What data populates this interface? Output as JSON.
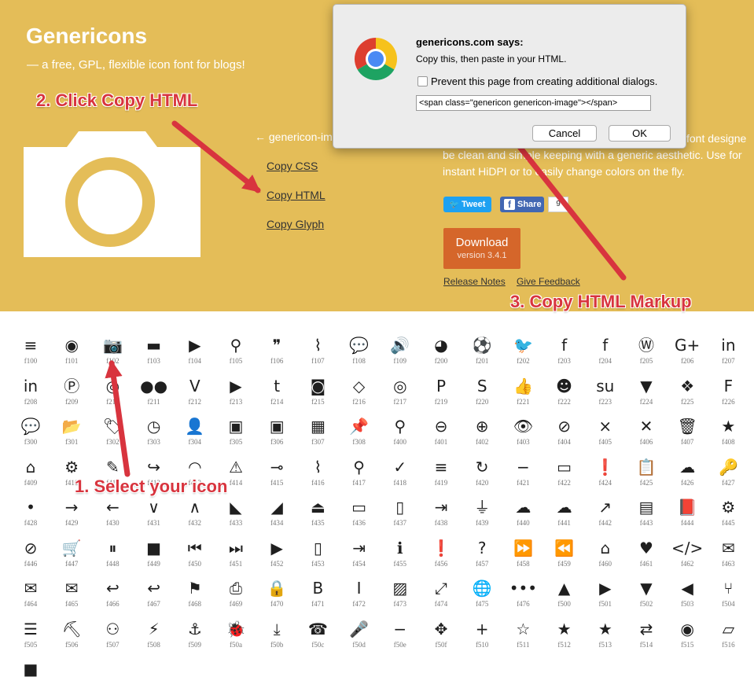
{
  "site": {
    "title": "Genericons",
    "tagline": "— a free, GPL, flexible icon font for blogs!"
  },
  "selected_icon": {
    "name": "← genericon-im",
    "copy_css": "Copy CSS",
    "copy_html": "Copy HTML",
    "copy_glyph": "Copy Glyph"
  },
  "description": {
    "line1": "font designe",
    "line2": "be clean and simple keeping with a generic aesthetic. Use for",
    "line3": "instant HiDPI or to easily change colors on the fly."
  },
  "social": {
    "tweet": "Tweet",
    "share": "Share",
    "count": "9"
  },
  "download": {
    "label": "Download",
    "version": "version 3.4.1"
  },
  "links": {
    "release_notes": "Release Notes",
    "give_feedback": "Give Feedback"
  },
  "annotations": {
    "step1": "1. Select your icon",
    "step2": "2. Click Copy HTML",
    "step3": "3. Copy HTML Markup"
  },
  "dialog": {
    "title": "genericons.com says:",
    "message": "Copy this, then paste in your HTML.",
    "checkbox_label": "Prevent this page from creating additional dialogs.",
    "input_value": "<span class=\"genericon genericon-image\"></span>",
    "cancel": "Cancel",
    "ok": "OK"
  },
  "colors": {
    "header_bg": "#e4bd58",
    "annotation_red": "#d8343e",
    "download_orange": "#d5662a",
    "tweet_blue": "#1da1f2",
    "facebook_blue": "#4267b2"
  },
  "icons": [
    [
      {
        "g": "≡",
        "c": "f100"
      },
      {
        "g": "◉",
        "c": "f101"
      },
      {
        "g": "📷",
        "c": "f102"
      },
      {
        "g": "▬",
        "c": "f103"
      },
      {
        "g": "▶",
        "c": "f104"
      },
      {
        "g": "⚲",
        "c": "f105"
      },
      {
        "g": "❞",
        "c": "f106"
      },
      {
        "g": "⌇",
        "c": "f107"
      },
      {
        "g": "💬",
        "c": "f108"
      },
      {
        "g": "🔊",
        "c": "f109"
      },
      {
        "g": "◕",
        "c": "f200"
      },
      {
        "g": "⚽",
        "c": "f201"
      },
      {
        "g": "🐦",
        "c": "f202"
      },
      {
        "g": "f",
        "c": "f203"
      },
      {
        "g": "f",
        "c": "f204"
      },
      {
        "g": "Ⓦ",
        "c": "f205"
      },
      {
        "g": "G+",
        "c": "f206"
      },
      {
        "g": "in",
        "c": "f207"
      }
    ],
    [
      {
        "g": "in",
        "c": "f208"
      },
      {
        "g": "Ⓟ",
        "c": "f209"
      },
      {
        "g": "◎",
        "c": "f210"
      },
      {
        "g": "●●",
        "c": "f211"
      },
      {
        "g": "V",
        "c": "f212"
      },
      {
        "g": "▶",
        "c": "f213"
      },
      {
        "g": "t",
        "c": "f214"
      },
      {
        "g": "◙",
        "c": "f215"
      },
      {
        "g": "◇",
        "c": "f216"
      },
      {
        "g": "◎",
        "c": "f217"
      },
      {
        "g": "P",
        "c": "f219"
      },
      {
        "g": "S",
        "c": "f220"
      },
      {
        "g": "👍",
        "c": "f221"
      },
      {
        "g": "☻",
        "c": "f222"
      },
      {
        "g": "su",
        "c": "f223"
      },
      {
        "g": "▼",
        "c": "f224"
      },
      {
        "g": "❖",
        "c": "f225"
      },
      {
        "g": "F",
        "c": "f226"
      }
    ],
    [
      {
        "g": "💬",
        "c": "f300"
      },
      {
        "g": "📂",
        "c": "f301"
      },
      {
        "g": "🏷",
        "c": "f302"
      },
      {
        "g": "◷",
        "c": "f303"
      },
      {
        "g": "👤",
        "c": "f304"
      },
      {
        "g": "▣",
        "c": "f305"
      },
      {
        "g": "▣",
        "c": "f306"
      },
      {
        "g": "▦",
        "c": "f307"
      },
      {
        "g": "📌",
        "c": "f308"
      },
      {
        "g": "⚲",
        "c": "f400"
      },
      {
        "g": "⊖",
        "c": "f401"
      },
      {
        "g": "⊕",
        "c": "f402"
      },
      {
        "g": "👁",
        "c": "f403"
      },
      {
        "g": "⊘",
        "c": "f404"
      },
      {
        "g": "×",
        "c": "f405"
      },
      {
        "g": "✕",
        "c": "f406"
      },
      {
        "g": "🗑",
        "c": "f407"
      },
      {
        "g": "★",
        "c": "f408"
      }
    ],
    [
      {
        "g": "⌂",
        "c": "f409"
      },
      {
        "g": "⚙",
        "c": "f410"
      },
      {
        "g": "✎",
        "c": "f411"
      },
      {
        "g": "↪",
        "c": "f412"
      },
      {
        "g": "◠",
        "c": "f413"
      },
      {
        "g": "⚠",
        "c": "f414"
      },
      {
        "g": "⊸",
        "c": "f415"
      },
      {
        "g": "⌇",
        "c": "f416"
      },
      {
        "g": "⚲",
        "c": "f417"
      },
      {
        "g": "✓",
        "c": "f418"
      },
      {
        "g": "≡",
        "c": "f419"
      },
      {
        "g": "↻",
        "c": "f420"
      },
      {
        "g": "−",
        "c": "f421"
      },
      {
        "g": "▭",
        "c": "f422"
      },
      {
        "g": "❗",
        "c": "f424"
      },
      {
        "g": "📋",
        "c": "f425"
      },
      {
        "g": "☁",
        "c": "f426"
      },
      {
        "g": "🔑",
        "c": "f427"
      }
    ],
    [
      {
        "g": "•",
        "c": "f428"
      },
      {
        "g": "→",
        "c": "f429"
      },
      {
        "g": "←",
        "c": "f430"
      },
      {
        "g": "∨",
        "c": "f431"
      },
      {
        "g": "∧",
        "c": "f432"
      },
      {
        "g": "◣",
        "c": "f433"
      },
      {
        "g": "◢",
        "c": "f434"
      },
      {
        "g": "⏏",
        "c": "f435"
      },
      {
        "g": "▭",
        "c": "f436"
      },
      {
        "g": "▯",
        "c": "f437"
      },
      {
        "g": "⇥",
        "c": "f438"
      },
      {
        "g": "⏚",
        "c": "f439"
      },
      {
        "g": "☁",
        "c": "f440"
      },
      {
        "g": "☁",
        "c": "f441"
      },
      {
        "g": "↗",
        "c": "f442"
      },
      {
        "g": "▤",
        "c": "f443"
      },
      {
        "g": "📕",
        "c": "f444"
      },
      {
        "g": "⚙",
        "c": "f445"
      }
    ],
    [
      {
        "g": "⊘",
        "c": "f446"
      },
      {
        "g": "🛒",
        "c": "f447"
      },
      {
        "g": "⏸",
        "c": "f448"
      },
      {
        "g": "■",
        "c": "f449"
      },
      {
        "g": "⏮",
        "c": "f450"
      },
      {
        "g": "⏭",
        "c": "f451"
      },
      {
        "g": "▶",
        "c": "f452"
      },
      {
        "g": "▯",
        "c": "f453"
      },
      {
        "g": "⇥",
        "c": "f454"
      },
      {
        "g": "ℹ",
        "c": "f455"
      },
      {
        "g": "❗",
        "c": "f456"
      },
      {
        "g": "?",
        "c": "f457"
      },
      {
        "g": "⏩",
        "c": "f458"
      },
      {
        "g": "⏪",
        "c": "f459"
      },
      {
        "g": "⌂",
        "c": "f460"
      },
      {
        "g": "♥",
        "c": "f461"
      },
      {
        "g": "</>",
        "c": "f462"
      },
      {
        "g": "✉",
        "c": "f463"
      }
    ],
    [
      {
        "g": "✉",
        "c": "f464"
      },
      {
        "g": "✉",
        "c": "f465"
      },
      {
        "g": "↩",
        "c": "f466"
      },
      {
        "g": "↩",
        "c": "f467"
      },
      {
        "g": "⚑",
        "c": "f468"
      },
      {
        "g": "⎙",
        "c": "f469"
      },
      {
        "g": "🔒",
        "c": "f470"
      },
      {
        "g": "B",
        "c": "f471"
      },
      {
        "g": "I",
        "c": "f472"
      },
      {
        "g": "▨",
        "c": "f473"
      },
      {
        "g": "⤢",
        "c": "f474"
      },
      {
        "g": "🌐",
        "c": "f475"
      },
      {
        "g": "•••",
        "c": "f476"
      },
      {
        "g": "▲",
        "c": "f500"
      },
      {
        "g": "▶",
        "c": "f501"
      },
      {
        "g": "▼",
        "c": "f502"
      },
      {
        "g": "◀",
        "c": "f503"
      },
      {
        "g": "⑂",
        "c": "f504"
      }
    ],
    [
      {
        "g": "☰",
        "c": "f505"
      },
      {
        "g": "⛏",
        "c": "f506"
      },
      {
        "g": "⚇",
        "c": "f507"
      },
      {
        "g": "⚡",
        "c": "f508"
      },
      {
        "g": "⚓",
        "c": "f509"
      },
      {
        "g": "🐞",
        "c": "f50a"
      },
      {
        "g": "⤓",
        "c": "f50b"
      },
      {
        "g": "☎",
        "c": "f50c"
      },
      {
        "g": "🎤",
        "c": "f50d"
      },
      {
        "g": "−",
        "c": "f50e"
      },
      {
        "g": "✥",
        "c": "f50f"
      },
      {
        "g": "+",
        "c": "f510"
      },
      {
        "g": "☆",
        "c": "f511"
      },
      {
        "g": "★",
        "c": "f512"
      },
      {
        "g": "★",
        "c": "f513"
      },
      {
        "g": "⇄",
        "c": "f514"
      },
      {
        "g": "◉",
        "c": "f515"
      },
      {
        "g": "▱",
        "c": "f516"
      }
    ],
    [
      {
        "g": "■",
        "c": ""
      }
    ]
  ]
}
